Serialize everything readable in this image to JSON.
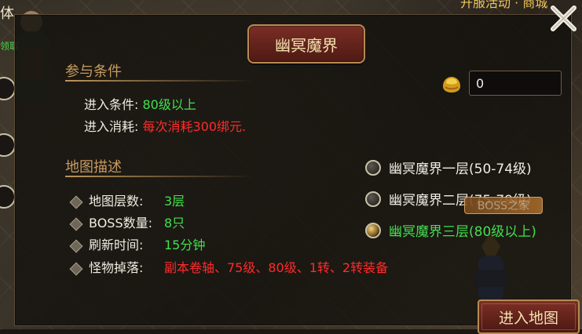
{
  "top_left_partial": "体",
  "top_left_green": "领取",
  "top_right_partial": "开服活动 · 商城",
  "window": {
    "title": "幽冥魔界"
  },
  "sections": {
    "requirements_title": "参与条件",
    "map_desc_title": "地图描述"
  },
  "requirements": [
    {
      "label": "进入条件: ",
      "value": "80级以上",
      "color": "#42e04f"
    },
    {
      "label": "进入消耗: ",
      "value": "每次消耗300绑元.",
      "color": "#ff2b2b"
    }
  ],
  "map_info": [
    {
      "label": "地图层数:",
      "value": "3层"
    },
    {
      "label": "BOSS数量:",
      "value": "8只"
    },
    {
      "label": "刷新时间:",
      "value": "15分钟"
    },
    {
      "label": "怪物掉落:",
      "value": "副本卷轴、75级、80级、1转、2转装备"
    }
  ],
  "currency": {
    "amount": "0",
    "icon": "gold-ingot-icon"
  },
  "floors": [
    {
      "label": "幽冥魔界一层(50-74级)",
      "selected": false
    },
    {
      "label": "幽冥魔界二层(75-79级)",
      "selected": false
    },
    {
      "label": "幽冥魔界三层(80级以上)",
      "selected": true
    }
  ],
  "boss_tag": "BOSS之家",
  "buttons": {
    "enter_map": "进入地图"
  },
  "colors": {
    "accent_gold": "#c79b5f",
    "green": "#42e04f",
    "red": "#ff2b2b",
    "selected_text": "#42e04f",
    "default_text": "#f0ece0"
  }
}
